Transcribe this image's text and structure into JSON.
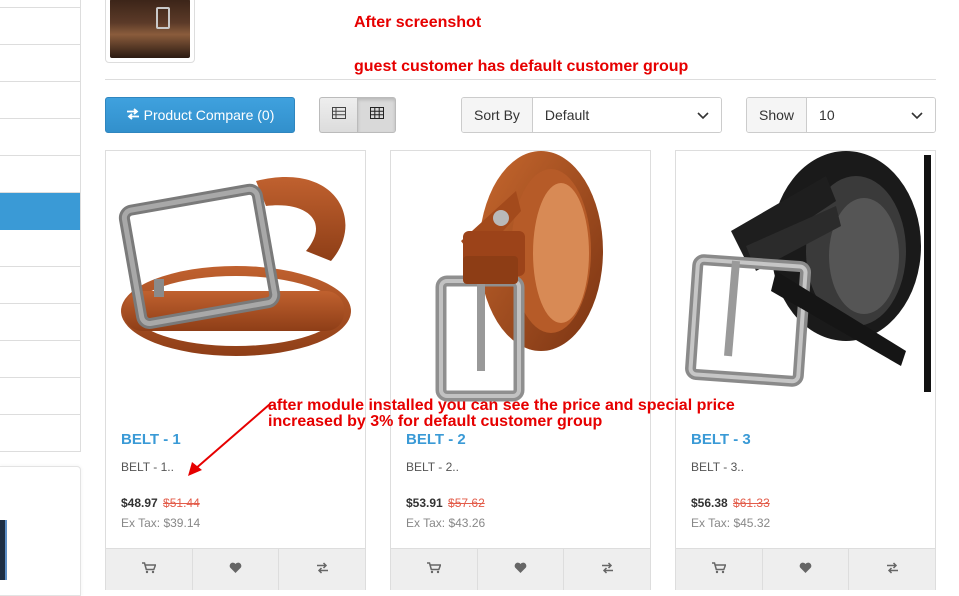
{
  "notes": {
    "line1": "After screenshot",
    "line2": "guest customer has default customer group",
    "annotation_line1": "after module installed you can see the price and special price",
    "annotation_line2": "increased by 3% for default customer group"
  },
  "toolbar": {
    "compare_label": "Product Compare (0)",
    "sort_label": "Sort By",
    "sort_value": "Default",
    "show_label": "Show",
    "show_value": "10"
  },
  "products": [
    {
      "title": "BELT - 1",
      "desc": "BELT - 1..",
      "price": "$48.97",
      "old_price": "$51.44",
      "tax": "Ex Tax: $39.14"
    },
    {
      "title": "BELT - 2",
      "desc": "BELT - 2..",
      "price": "$53.91",
      "old_price": "$57.62",
      "tax": "Ex Tax: $43.26"
    },
    {
      "title": "BELT - 3",
      "desc": "BELT - 3..",
      "price": "$56.38",
      "old_price": "$61.33",
      "tax": "Ex Tax: $45.32"
    }
  ],
  "colors": {
    "accent": "#3a9ad6",
    "note_red": "#e60000",
    "old_price": "#e35c4a"
  },
  "icons": [
    "exchange-icon",
    "list-view-icon",
    "grid-view-icon",
    "chevron-down-icon",
    "cart-icon",
    "heart-icon",
    "compare-icon"
  ]
}
